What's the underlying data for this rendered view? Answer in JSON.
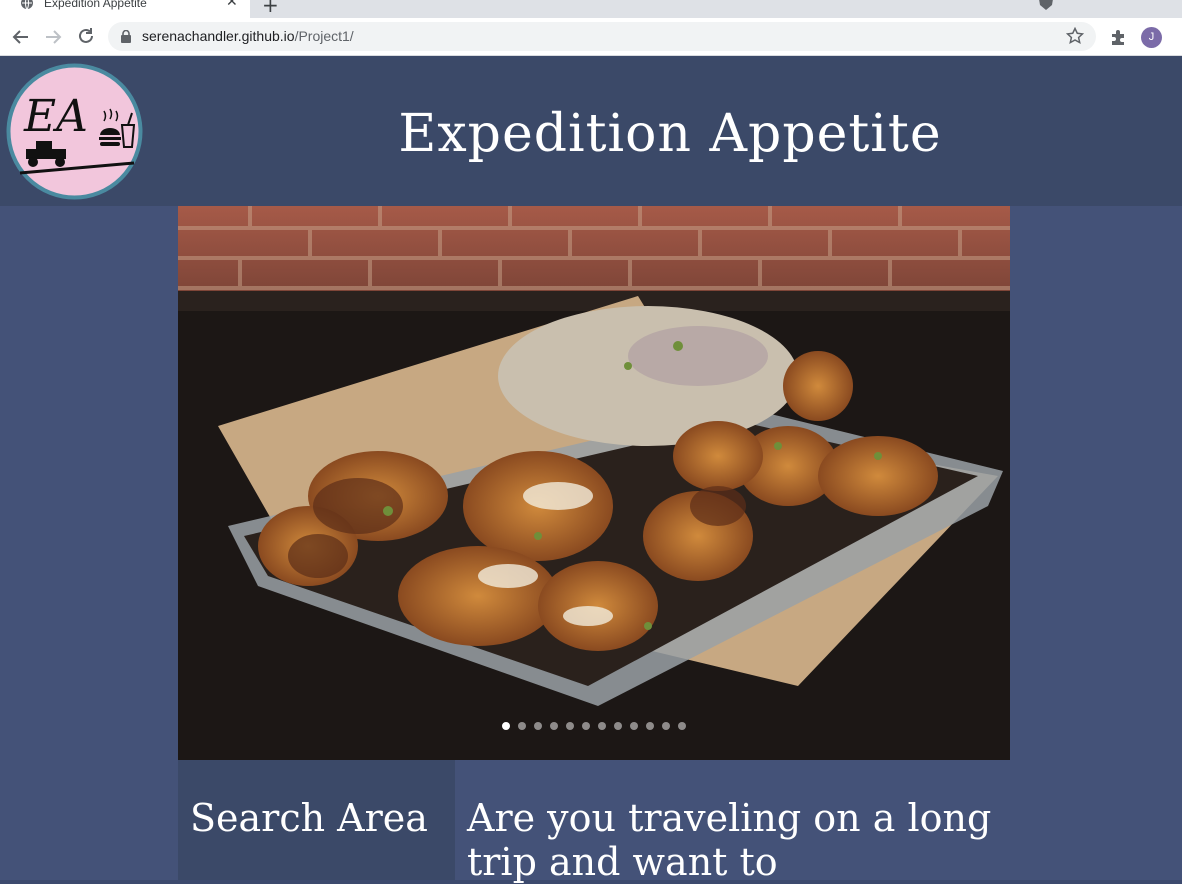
{
  "browser": {
    "tab_title": "Expedition Appetite",
    "tab_close": "✕",
    "new_tab": "+",
    "url_host": "serenachandler.github.io",
    "url_path": "/Project1/",
    "avatar_initial": "J"
  },
  "header": {
    "logo_text": "EA",
    "title": "Expedition Appetite"
  },
  "carousel": {
    "image_alt": "Tray of fried cauliflower with slaw",
    "slide_count": 12,
    "active_index": 0
  },
  "sidebar": {
    "title": "Search Area"
  },
  "main": {
    "intro_text": "Are you traveling on a long trip and want to"
  },
  "colors": {
    "header_bg": "#3b4968",
    "page_bg": "#445278",
    "logo_bg": "#f2c6dc",
    "logo_border": "#4a8aa0"
  }
}
